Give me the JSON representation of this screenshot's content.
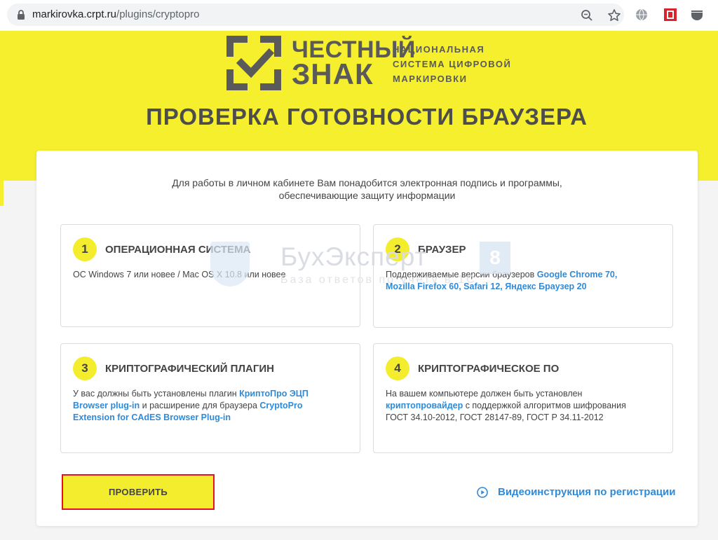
{
  "browser": {
    "url_host": "markirovka.crpt.ru",
    "url_path": "/plugins/cryptopro",
    "icons": [
      "lock-icon",
      "zoom-icon",
      "star-icon",
      "globe-extension-icon",
      "red-extension-icon",
      "gray-extension-icon"
    ]
  },
  "header": {
    "logo_word1": "ЧЕСТНЫЙ",
    "logo_word2": "ЗНАК",
    "logo_tagline": [
      "НАЦИОНАЛЬНАЯ",
      "СИСТЕМА ЦИФРОВОЙ",
      "МАРКИРОВКИ"
    ],
    "title": "ПРОВЕРКА ГОТОВНОСТИ БРАУЗЕРА"
  },
  "intro": {
    "line1": "Для работы в личном кабинете Вам понадобится электронная подпись и программы,",
    "line2": "обеспечивающие защиту информации"
  },
  "steps": [
    {
      "number": "1",
      "title": "ОПЕРАЦИОННАЯ СИСТЕМА",
      "text": "ОС Windows 7 или новее / Mac OS X 10.8 или новее"
    },
    {
      "number": "2",
      "title": "БРАУЗЕР",
      "text_prefix": "Поддерживаемые версии браузеров ",
      "link1": "Google Chrome 70,",
      "link2": "Mozilla Firefox 60,",
      "link3": "Safari 12,",
      "link4": "Яндекс Браузер 20"
    },
    {
      "number": "3",
      "title": "КРИПТОГРАФИЧЕСКИЙ ПЛАГИН",
      "text_prefix": "У вас должны быть установлены плагин ",
      "link1": "КриптоПро ЭЦП Browser plug-in",
      "text_middle": " и расширение для браузера ",
      "link2": "CryptoPro Extension for CAdES Browser Plug-in"
    },
    {
      "number": "4",
      "title": "КРИПТОГРАФИЧЕСКОЕ ПО",
      "text_prefix": "На вашем компьютере должен быть установлен",
      "link1": "криптопровайдер",
      "text_suffix": " с поддержкой алгоритмов шифрования ГОСТ 34.10-2012, ГОСТ 28147-89, ГОСТ Р 34.11-2012"
    }
  ],
  "watermark": {
    "title": "БухЭксперт",
    "badge": "8",
    "subtitle": "База ответов по учету в 1С"
  },
  "actions": {
    "check_label": "ПРОВЕРИТЬ",
    "video_label": "Видеоинструкция по регистрации"
  },
  "colors": {
    "brand_yellow": "#f5ef2d",
    "link_blue": "#2f8ad8",
    "highlight_red": "#e5141c",
    "logo_gray": "#5a5a5a"
  }
}
